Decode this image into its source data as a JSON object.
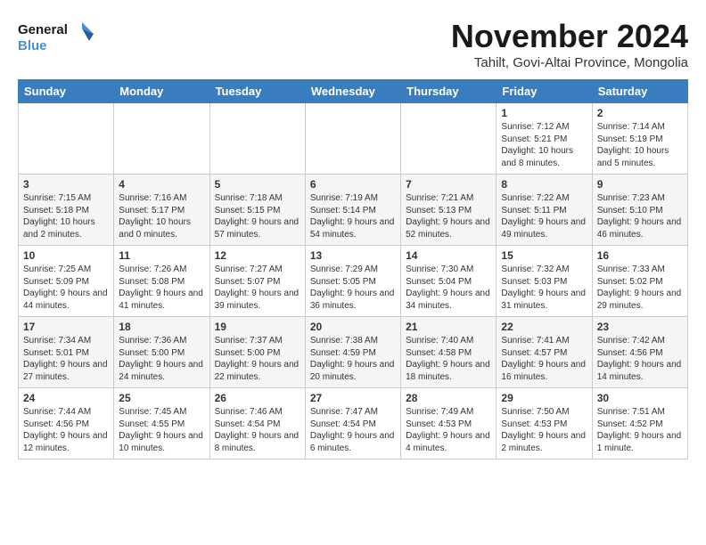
{
  "logo": {
    "line1": "General",
    "line2": "Blue"
  },
  "title": "November 2024",
  "location": "Tahilt, Govi-Altai Province, Mongolia",
  "weekdays": [
    "Sunday",
    "Monday",
    "Tuesday",
    "Wednesday",
    "Thursday",
    "Friday",
    "Saturday"
  ],
  "weeks": [
    [
      {
        "day": "",
        "info": ""
      },
      {
        "day": "",
        "info": ""
      },
      {
        "day": "",
        "info": ""
      },
      {
        "day": "",
        "info": ""
      },
      {
        "day": "",
        "info": ""
      },
      {
        "day": "1",
        "info": "Sunrise: 7:12 AM\nSunset: 5:21 PM\nDaylight: 10 hours and 8 minutes."
      },
      {
        "day": "2",
        "info": "Sunrise: 7:14 AM\nSunset: 5:19 PM\nDaylight: 10 hours and 5 minutes."
      }
    ],
    [
      {
        "day": "3",
        "info": "Sunrise: 7:15 AM\nSunset: 5:18 PM\nDaylight: 10 hours and 2 minutes."
      },
      {
        "day": "4",
        "info": "Sunrise: 7:16 AM\nSunset: 5:17 PM\nDaylight: 10 hours and 0 minutes."
      },
      {
        "day": "5",
        "info": "Sunrise: 7:18 AM\nSunset: 5:15 PM\nDaylight: 9 hours and 57 minutes."
      },
      {
        "day": "6",
        "info": "Sunrise: 7:19 AM\nSunset: 5:14 PM\nDaylight: 9 hours and 54 minutes."
      },
      {
        "day": "7",
        "info": "Sunrise: 7:21 AM\nSunset: 5:13 PM\nDaylight: 9 hours and 52 minutes."
      },
      {
        "day": "8",
        "info": "Sunrise: 7:22 AM\nSunset: 5:11 PM\nDaylight: 9 hours and 49 minutes."
      },
      {
        "day": "9",
        "info": "Sunrise: 7:23 AM\nSunset: 5:10 PM\nDaylight: 9 hours and 46 minutes."
      }
    ],
    [
      {
        "day": "10",
        "info": "Sunrise: 7:25 AM\nSunset: 5:09 PM\nDaylight: 9 hours and 44 minutes."
      },
      {
        "day": "11",
        "info": "Sunrise: 7:26 AM\nSunset: 5:08 PM\nDaylight: 9 hours and 41 minutes."
      },
      {
        "day": "12",
        "info": "Sunrise: 7:27 AM\nSunset: 5:07 PM\nDaylight: 9 hours and 39 minutes."
      },
      {
        "day": "13",
        "info": "Sunrise: 7:29 AM\nSunset: 5:05 PM\nDaylight: 9 hours and 36 minutes."
      },
      {
        "day": "14",
        "info": "Sunrise: 7:30 AM\nSunset: 5:04 PM\nDaylight: 9 hours and 34 minutes."
      },
      {
        "day": "15",
        "info": "Sunrise: 7:32 AM\nSunset: 5:03 PM\nDaylight: 9 hours and 31 minutes."
      },
      {
        "day": "16",
        "info": "Sunrise: 7:33 AM\nSunset: 5:02 PM\nDaylight: 9 hours and 29 minutes."
      }
    ],
    [
      {
        "day": "17",
        "info": "Sunrise: 7:34 AM\nSunset: 5:01 PM\nDaylight: 9 hours and 27 minutes."
      },
      {
        "day": "18",
        "info": "Sunrise: 7:36 AM\nSunset: 5:00 PM\nDaylight: 9 hours and 24 minutes."
      },
      {
        "day": "19",
        "info": "Sunrise: 7:37 AM\nSunset: 5:00 PM\nDaylight: 9 hours and 22 minutes."
      },
      {
        "day": "20",
        "info": "Sunrise: 7:38 AM\nSunset: 4:59 PM\nDaylight: 9 hours and 20 minutes."
      },
      {
        "day": "21",
        "info": "Sunrise: 7:40 AM\nSunset: 4:58 PM\nDaylight: 9 hours and 18 minutes."
      },
      {
        "day": "22",
        "info": "Sunrise: 7:41 AM\nSunset: 4:57 PM\nDaylight: 9 hours and 16 minutes."
      },
      {
        "day": "23",
        "info": "Sunrise: 7:42 AM\nSunset: 4:56 PM\nDaylight: 9 hours and 14 minutes."
      }
    ],
    [
      {
        "day": "24",
        "info": "Sunrise: 7:44 AM\nSunset: 4:56 PM\nDaylight: 9 hours and 12 minutes."
      },
      {
        "day": "25",
        "info": "Sunrise: 7:45 AM\nSunset: 4:55 PM\nDaylight: 9 hours and 10 minutes."
      },
      {
        "day": "26",
        "info": "Sunrise: 7:46 AM\nSunset: 4:54 PM\nDaylight: 9 hours and 8 minutes."
      },
      {
        "day": "27",
        "info": "Sunrise: 7:47 AM\nSunset: 4:54 PM\nDaylight: 9 hours and 6 minutes."
      },
      {
        "day": "28",
        "info": "Sunrise: 7:49 AM\nSunset: 4:53 PM\nDaylight: 9 hours and 4 minutes."
      },
      {
        "day": "29",
        "info": "Sunrise: 7:50 AM\nSunset: 4:53 PM\nDaylight: 9 hours and 2 minutes."
      },
      {
        "day": "30",
        "info": "Sunrise: 7:51 AM\nSunset: 4:52 PM\nDaylight: 9 hours and 1 minute."
      }
    ]
  ]
}
